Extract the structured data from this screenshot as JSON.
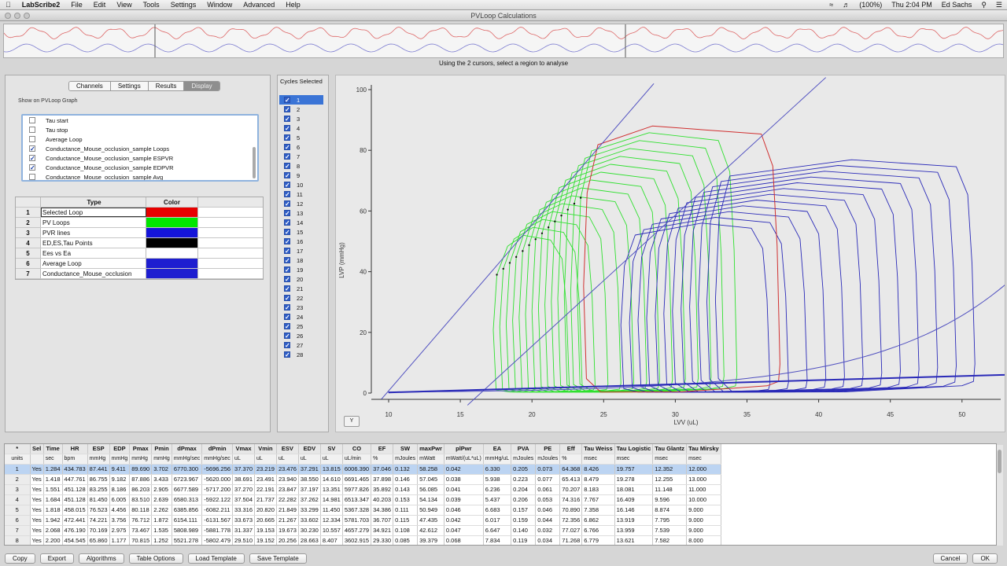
{
  "menubar": {
    "app": "LabScribe2",
    "items": [
      "File",
      "Edit",
      "View",
      "Tools",
      "Settings",
      "Window",
      "Advanced",
      "Help"
    ],
    "clock": "Thu 2:04 PM",
    "user": "Ed Sachs",
    "battery": "(100%)"
  },
  "window": {
    "title": "PVLoop Calculations"
  },
  "overview": {
    "instruction": "Using the 2 cursors, select a region to analyse"
  },
  "left_panel": {
    "tabs": [
      "Channels",
      "Settings",
      "Results",
      "Display"
    ],
    "selected_tab": "Display",
    "show_label": "Show on PVLoop Graph",
    "checklist": [
      {
        "label": "Tau start",
        "checked": false
      },
      {
        "label": "Tau stop",
        "checked": false
      },
      {
        "label": "Average Loop",
        "checked": false
      },
      {
        "label": "Conductance_Mouse_occlusion_sample Loops",
        "checked": true
      },
      {
        "label": "Conductance_Mouse_occlusion_sample ESPVR",
        "checked": true
      },
      {
        "label": "Conductance_Mouse_occlusion_sample EDPVR",
        "checked": true
      },
      {
        "label": "Conductance_Mouse_occlusion_sample Avg",
        "checked": false
      }
    ],
    "color_table": {
      "headers": [
        "Type",
        "Color"
      ],
      "rows": [
        {
          "num": "1",
          "type": "Selected Loop",
          "color": "#e60000"
        },
        {
          "num": "2",
          "type": "PV Loops",
          "color": "#00e600"
        },
        {
          "num": "3",
          "type": "PVR lines",
          "color": "#1414d8"
        },
        {
          "num": "4",
          "type": "ED,ES,Tau Points",
          "color": "#000000"
        },
        {
          "num": "5",
          "type": "Ees vs Ea",
          "color": ""
        },
        {
          "num": "6",
          "type": "Average Loop",
          "color": "#1e1ed0"
        },
        {
          "num": "7",
          "type": "Conductance_Mouse_occlusion",
          "color": "#1e1ed0"
        }
      ]
    }
  },
  "cycles": {
    "header": "Cycles Selected",
    "items": [
      "1",
      "2",
      "3",
      "4",
      "5",
      "6",
      "7",
      "8",
      "9",
      "10",
      "11",
      "12",
      "13",
      "14",
      "15",
      "16",
      "17",
      "18",
      "19",
      "20",
      "21",
      "22",
      "23",
      "24",
      "25",
      "26",
      "27",
      "28"
    ]
  },
  "plot": {
    "xlabel": "LVV (uL)",
    "ylabel": "LVP (mmHg)",
    "y_button": "Y",
    "xticks": [
      "10",
      "15",
      "20",
      "25",
      "30",
      "35",
      "40",
      "45",
      "50"
    ],
    "yticks": [
      "0",
      "20",
      "40",
      "60",
      "80",
      "100"
    ],
    "colors": {
      "green": "#2fe02f",
      "blue": "#2a2ab8",
      "red": "#d03030",
      "pvr": "#5050c0"
    }
  },
  "table": {
    "headers": [
      "*",
      "Sel",
      "Time",
      "HR",
      "ESP",
      "EDP",
      "Pmax",
      "Pmin",
      "dPmax",
      "dPmin",
      "Vmax",
      "Vmin",
      "ESV",
      "EDV",
      "SV",
      "CO",
      "EF",
      "SW",
      "maxPwr",
      "plPwr",
      "EA",
      "PVA",
      "PE",
      "Eff",
      "Tau Weiss",
      "Tau Logistic",
      "Tau Glantz",
      "Tau Mirsky"
    ],
    "units": [
      "units",
      "",
      "sec",
      "bpm",
      "mmHg",
      "mmHg",
      "mmHg",
      "mmHg",
      "mmHg/sec",
      "mmHg/sec",
      "uL",
      "uL",
      "uL",
      "uL",
      "uL",
      "uL/min",
      "%",
      "mJoules",
      "mWatt",
      "mWatt/(uL*uL)",
      "mmHg/uL",
      "mJoules",
      "mJoules",
      "%",
      "msec",
      "msec",
      "msec",
      "msec"
    ],
    "rows": [
      [
        "1",
        "Yes",
        "1.284",
        "434.783",
        "87.441",
        "9.411",
        "89.690",
        "3.702",
        "6770.300",
        "-5696.256",
        "37.370",
        "23.219",
        "23.476",
        "37.291",
        "13.815",
        "6006.390",
        "37.046",
        "0.132",
        "58.258",
        "0.042",
        "6.330",
        "0.205",
        "0.073",
        "64.368",
        "8.426",
        "19.757",
        "12.352",
        "12.000"
      ],
      [
        "2",
        "Yes",
        "1.418",
        "447.761",
        "86.755",
        "9.182",
        "87.886",
        "3.433",
        "6723.967",
        "-5620.000",
        "38.691",
        "23.491",
        "23.940",
        "38.550",
        "14.610",
        "6691.465",
        "37.898",
        "0.146",
        "57.045",
        "0.038",
        "5.938",
        "0.223",
        "0.077",
        "65.413",
        "8.479",
        "19.278",
        "12.255",
        "13.000"
      ],
      [
        "3",
        "Yes",
        "1.551",
        "451.128",
        "83.255",
        "8.186",
        "86.203",
        "2.905",
        "6677.589",
        "-5717.200",
        "37.270",
        "22.191",
        "23.847",
        "37.197",
        "13.351",
        "5977.826",
        "35.892",
        "0.143",
        "56.085",
        "0.041",
        "6.236",
        "0.204",
        "0.061",
        "70.207",
        "8.183",
        "18.081",
        "11.148",
        "11.000"
      ],
      [
        "4",
        "Yes",
        "1.684",
        "451.128",
        "81.450",
        "6.005",
        "83.510",
        "2.639",
        "6580.313",
        "-5922.122",
        "37.504",
        "21.737",
        "22.282",
        "37.262",
        "14.981",
        "6513.347",
        "40.203",
        "0.153",
        "54.134",
        "0.039",
        "5.437",
        "0.206",
        "0.053",
        "74.316",
        "7.767",
        "16.409",
        "9.596",
        "10.000"
      ],
      [
        "5",
        "Yes",
        "1.818",
        "458.015",
        "76.523",
        "4.456",
        "80.118",
        "2.262",
        "6385.856",
        "-6082.211",
        "33.316",
        "20.820",
        "21.849",
        "33.299",
        "11.450",
        "5367.328",
        "34.386",
        "0.111",
        "50.949",
        "0.046",
        "6.683",
        "0.157",
        "0.046",
        "70.890",
        "7.358",
        "16.146",
        "8.874",
        "9.000"
      ],
      [
        "6",
        "Yes",
        "1.942",
        "472.441",
        "74.221",
        "3.756",
        "76.712",
        "1.872",
        "6154.111",
        "-6131.567",
        "33.673",
        "20.665",
        "21.267",
        "33.602",
        "12.334",
        "5781.703",
        "36.707",
        "0.115",
        "47.435",
        "0.042",
        "6.017",
        "0.159",
        "0.044",
        "72.356",
        "6.862",
        "13.919",
        "7.795",
        "9.000"
      ],
      [
        "7",
        "Yes",
        "2.068",
        "476.190",
        "70.169",
        "2.975",
        "73.467",
        "1.535",
        "5808.989",
        "-5881.778",
        "31.337",
        "19.153",
        "19.673",
        "30.230",
        "10.557",
        "4657.279",
        "34.921",
        "0.108",
        "42.612",
        "0.047",
        "6.647",
        "0.140",
        "0.032",
        "77.027",
        "6.766",
        "13.959",
        "7.539",
        "9.000"
      ],
      [
        "8",
        "Yes",
        "2.200",
        "454.545",
        "65.860",
        "1.177",
        "70.815",
        "1.252",
        "5521.278",
        "-5802.479",
        "29.510",
        "19.152",
        "20.256",
        "28.663",
        "8.407",
        "3602.915",
        "29.330",
        "0.085",
        "39.379",
        "0.068",
        "7.834",
        "0.119",
        "0.034",
        "71.268",
        "6.779",
        "13.621",
        "7.582",
        "8.000"
      ]
    ]
  },
  "buttons": {
    "left": [
      "Copy",
      "Export",
      "Algorithms",
      "Table Options",
      "Load Template",
      "Save Template"
    ],
    "right": [
      "Cancel",
      "OK"
    ]
  }
}
